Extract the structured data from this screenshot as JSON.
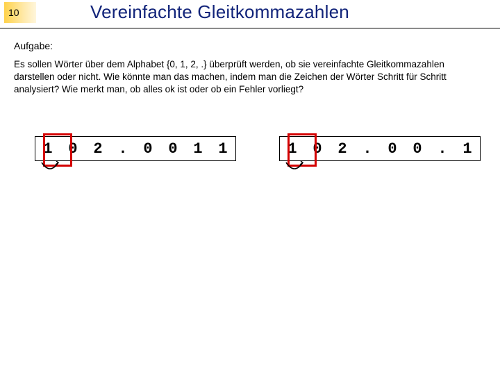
{
  "slide_number": "10",
  "title": "Vereinfachte Gleitkommazahlen",
  "task_label": "Aufgabe:",
  "body": "Es sollen Wörter über dem Alphabet {0, 1, 2, .} überprüft werden, ob sie vereinfachte Gleitkommazahlen darstellen oder nicht. Wie könnte man das machen, indem man die Zeichen der Wörter Schritt für Schritt analysiert? Wie merkt man, ob alles ok ist oder ob ein Fehler vorliegt?",
  "tapes": {
    "left": {
      "cells": [
        "1",
        "0",
        "2",
        ".",
        "0",
        "0",
        "1",
        "1"
      ],
      "highlight_index": 0
    },
    "right": {
      "cells": [
        "1",
        "0",
        "2",
        ".",
        "0",
        "0",
        ".",
        "1"
      ],
      "highlight_index": 0
    }
  }
}
